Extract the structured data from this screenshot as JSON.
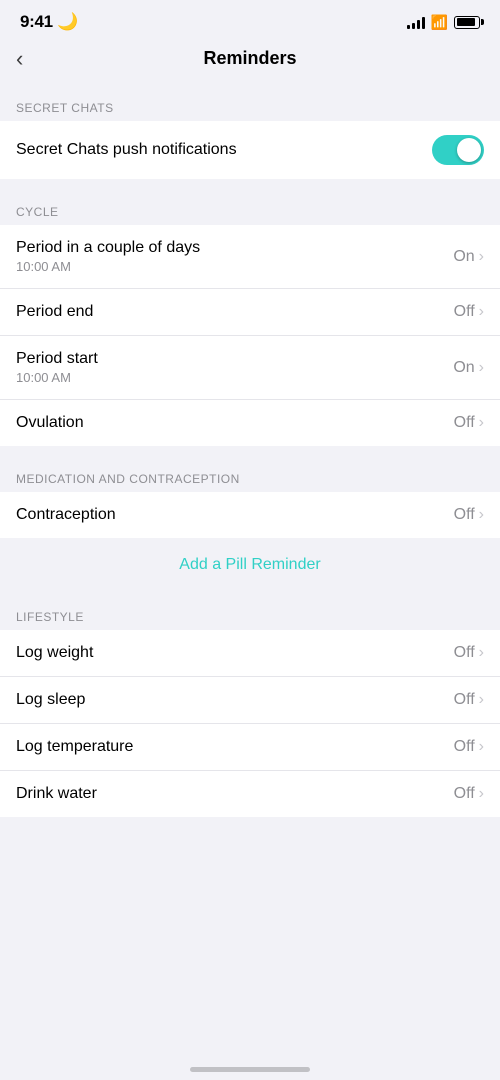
{
  "statusBar": {
    "time": "9:41",
    "moonIcon": "🌙"
  },
  "header": {
    "backLabel": "<",
    "title": "Reminders"
  },
  "sections": [
    {
      "id": "secret-chats",
      "label": "SECRET CHATS",
      "rows": [
        {
          "id": "secret-chats-push",
          "title": "Secret Chats push notifications",
          "subtitle": null,
          "value": null,
          "toggle": true,
          "toggleOn": true
        }
      ]
    },
    {
      "id": "cycle",
      "label": "CYCLE",
      "rows": [
        {
          "id": "period-couple-days",
          "title": "Period in a couple of days",
          "subtitle": "10:00 AM",
          "value": "On",
          "toggle": false
        },
        {
          "id": "period-end",
          "title": "Period end",
          "subtitle": null,
          "value": "Off",
          "toggle": false
        },
        {
          "id": "period-start",
          "title": "Period start",
          "subtitle": "10:00 AM",
          "value": "On",
          "toggle": false
        },
        {
          "id": "ovulation",
          "title": "Ovulation",
          "subtitle": null,
          "value": "Off",
          "toggle": false
        }
      ]
    },
    {
      "id": "medication",
      "label": "MEDICATION AND CONTRACEPTION",
      "rows": [
        {
          "id": "contraception",
          "title": "Contraception",
          "subtitle": null,
          "value": "Off",
          "toggle": false
        }
      ]
    },
    {
      "id": "lifestyle",
      "label": "LIFESTYLE",
      "rows": [
        {
          "id": "log-weight",
          "title": "Log weight",
          "subtitle": null,
          "value": "Off",
          "toggle": false
        },
        {
          "id": "log-sleep",
          "title": "Log sleep",
          "subtitle": null,
          "value": "Off",
          "toggle": false
        },
        {
          "id": "log-temperature",
          "title": "Log temperature",
          "subtitle": null,
          "value": "Off",
          "toggle": false
        },
        {
          "id": "drink-water",
          "title": "Drink water",
          "subtitle": null,
          "value": "Off",
          "toggle": false
        }
      ]
    }
  ],
  "pillReminderLink": "Add a Pill Reminder"
}
